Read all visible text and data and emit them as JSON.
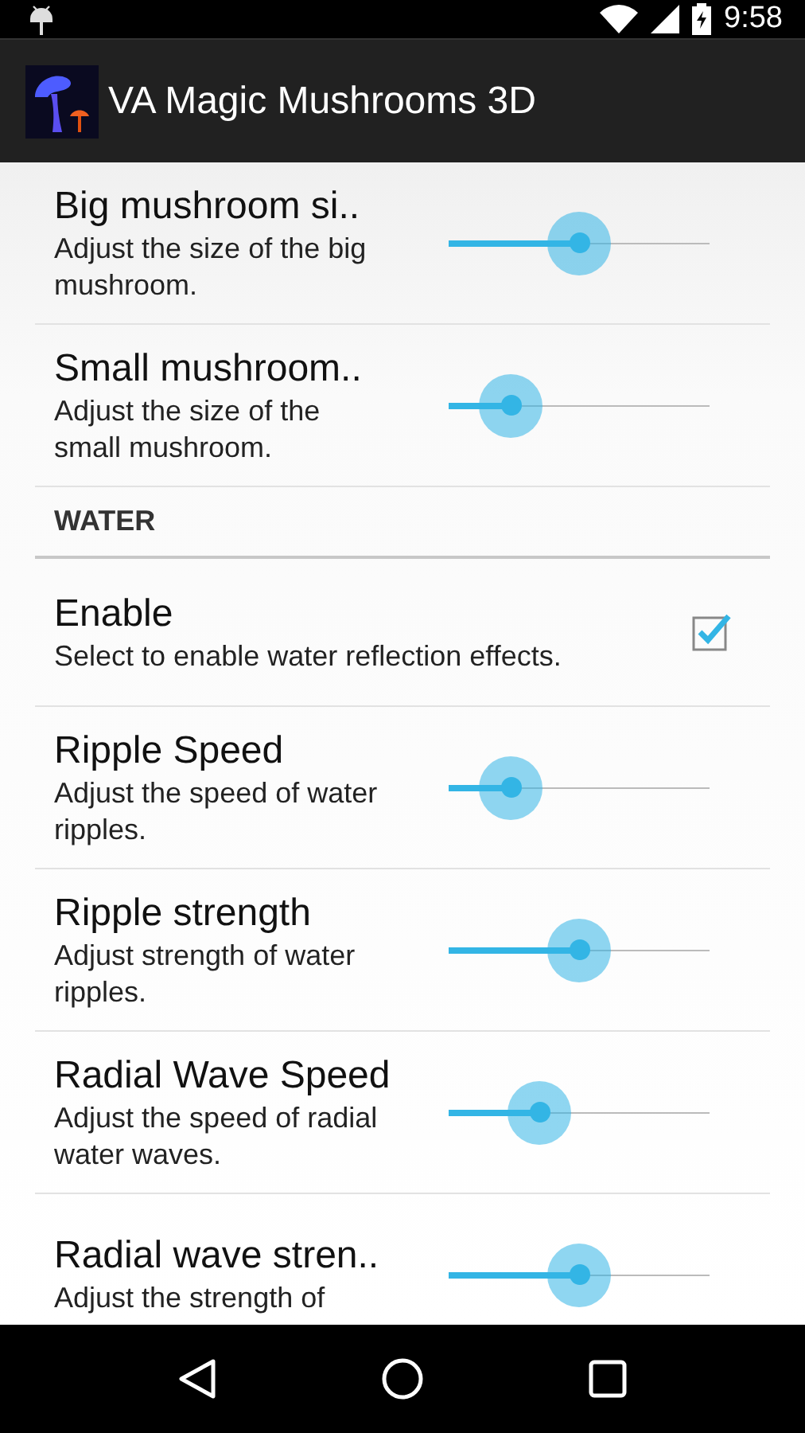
{
  "status_bar": {
    "time": "9:58"
  },
  "action_bar": {
    "title": "VA Magic Mushrooms 3D"
  },
  "items": [
    {
      "kind": "slider",
      "title": "Big mushroom si..",
      "summary": "Adjust the size of the big mushroom.",
      "level": 0.5
    },
    {
      "kind": "slider",
      "title": "Small mushroom..",
      "summary": "Adjust the size of the small mushroom.",
      "level": 0.24
    },
    {
      "kind": "category",
      "title": "WATER"
    },
    {
      "kind": "checkbox",
      "title": "Enable",
      "summary": "Select to enable water reflection effects.",
      "checked": true
    },
    {
      "kind": "slider",
      "title": "Ripple Speed",
      "summary": "Adjust the speed of water ripples.",
      "level": 0.24
    },
    {
      "kind": "slider",
      "title": "Ripple strength",
      "summary": "Adjust strength of water ripples.",
      "level": 0.5
    },
    {
      "kind": "slider",
      "title": "Radial Wave Speed",
      "summary": "Adjust the speed of radial water waves.",
      "level": 0.35
    },
    {
      "kind": "slider",
      "title": "Radial wave stren..",
      "summary": "Adjust the strength of",
      "level": 0.5
    }
  ]
}
